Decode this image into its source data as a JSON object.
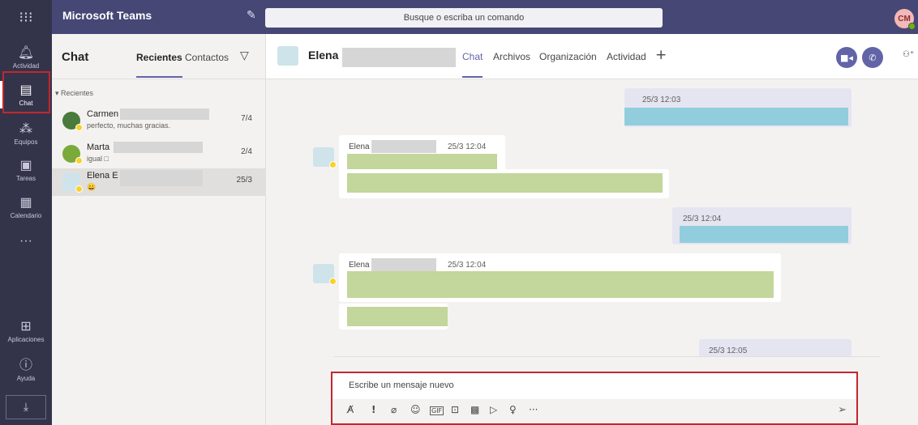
{
  "app": {
    "title": "Microsoft Teams",
    "search_placeholder": "Busque o escriba un comando",
    "user_initials": "CM"
  },
  "rail": {
    "items": [
      {
        "label": "Actividad",
        "icon": "bell-icon"
      },
      {
        "label": "Chat",
        "icon": "chat-icon"
      },
      {
        "label": "Equipos",
        "icon": "teams-icon"
      },
      {
        "label": "Tareas",
        "icon": "tasks-icon"
      },
      {
        "label": "Calendario",
        "icon": "calendar-icon"
      },
      {
        "label": "···",
        "icon": "more-icon"
      }
    ],
    "bottom": [
      {
        "label": "Aplicaciones",
        "icon": "apps-icon"
      },
      {
        "label": "Ayuda",
        "icon": "help-icon"
      }
    ]
  },
  "chat_list": {
    "title": "Chat",
    "tabs": [
      "Recientes",
      "Contactos"
    ],
    "section_label": "Recientes",
    "items": [
      {
        "name": "Carmen",
        "preview": "perfecto, muchas gracias.",
        "date": "7/4"
      },
      {
        "name": "Marta",
        "preview": "igual □",
        "date": "2/4"
      },
      {
        "name": "Elena E",
        "preview": "😀",
        "date": "25/3"
      }
    ]
  },
  "conversation": {
    "contact_name": "Elena",
    "tabs": [
      "Chat",
      "Archivos",
      "Organización",
      "Actividad"
    ],
    "messages": [
      {
        "direction": "out",
        "time": "25/3 12:03"
      },
      {
        "direction": "in",
        "sender": "Elena",
        "time": "25/3 12:04"
      },
      {
        "direction": "out",
        "time": "25/3 12:04"
      },
      {
        "direction": "in",
        "sender": "Elena",
        "time": "25/3 12:04"
      },
      {
        "direction": "out",
        "time": "25/3 12:05"
      }
    ],
    "composer_placeholder": "Escribe un mensaje nuevo"
  },
  "colors": {
    "accent": "#6264a7",
    "topbar": "#464775",
    "rail": "#33344a",
    "highlight": "#c4262e",
    "redact_blue": "#92cddd",
    "redact_green": "#c3d69b"
  }
}
